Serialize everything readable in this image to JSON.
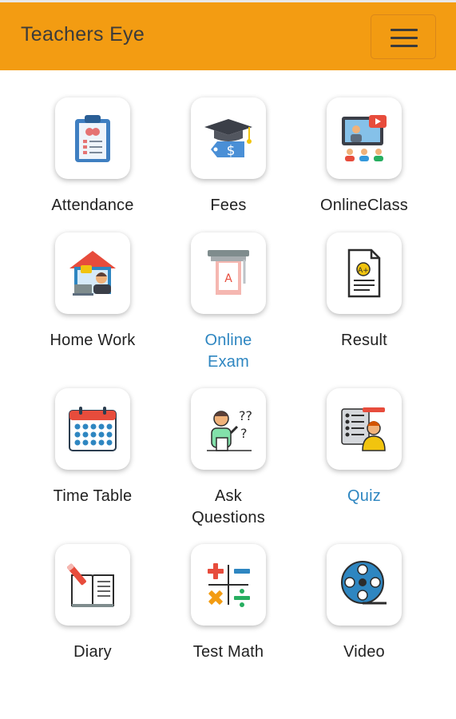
{
  "app": {
    "title": "Teachers Eye"
  },
  "colors": {
    "header": "#f39c12",
    "link": "#2e86c1",
    "text": "#222222"
  },
  "tiles": [
    {
      "label": "Attendance",
      "icon": "clipboard-icon",
      "link": false
    },
    {
      "label": "Fees",
      "icon": "graduation-fee-icon",
      "link": false
    },
    {
      "label": "OnlineClass",
      "icon": "online-class-icon",
      "link": false
    },
    {
      "label": "Home Work",
      "icon": "home-work-icon",
      "link": false
    },
    {
      "label": "Online\nExam",
      "icon": "exam-sheet-icon",
      "link": true
    },
    {
      "label": "Result",
      "icon": "result-doc-icon",
      "link": false
    },
    {
      "label": "Time Table",
      "icon": "calendar-icon",
      "link": false
    },
    {
      "label": "Ask\nQuestions",
      "icon": "question-person-icon",
      "link": false
    },
    {
      "label": "Quiz",
      "icon": "quiz-icon",
      "link": true
    },
    {
      "label": "Diary",
      "icon": "diary-book-icon",
      "link": false
    },
    {
      "label": "Test Math",
      "icon": "math-symbols-icon",
      "link": false
    },
    {
      "label": "Video",
      "icon": "film-reel-icon",
      "link": false
    }
  ]
}
